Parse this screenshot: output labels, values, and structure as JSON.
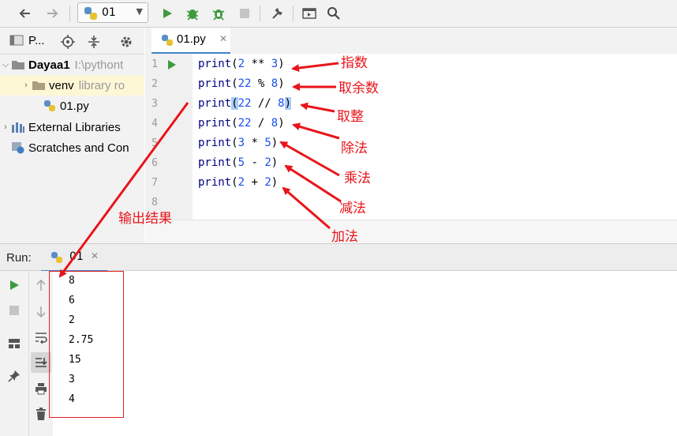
{
  "toolbar": {
    "run_config": "01"
  },
  "project": {
    "header_label": "P...",
    "tree": [
      {
        "name": "Dayaa1",
        "extra": "I:\\pythont"
      },
      {
        "name": "venv",
        "extra": "library ro"
      },
      {
        "name": "01.py",
        "extra": ""
      },
      {
        "name": "External Libraries",
        "extra": ""
      },
      {
        "name": "Scratches and Con",
        "extra": ""
      }
    ]
  },
  "editor": {
    "tab": "01.py",
    "line_numbers": [
      "1",
      "2",
      "3",
      "4",
      "5",
      "6",
      "7",
      "8"
    ],
    "lines": [
      "print(2 ** 3)",
      "print(22 % 8)",
      "print(22 // 8)",
      "print(22 / 8)",
      "print(3 * 5)",
      "print(5 - 2)",
      "print(2 + 2)",
      ""
    ]
  },
  "annotations": {
    "power": "指数",
    "modulo": "取余数",
    "floor_div": "取整",
    "division": "除法",
    "multiply": "乘法",
    "subtract": "减法",
    "add": "加法",
    "output": "输出结果"
  },
  "run": {
    "label": "Run:",
    "tab": "01",
    "output": [
      "8",
      "6",
      "2",
      "2.75",
      "15",
      "3",
      "4"
    ]
  },
  "colors": {
    "accent": "#4083c9",
    "annotation_red": "#e8151b",
    "run_green": "#3e9a3e"
  }
}
